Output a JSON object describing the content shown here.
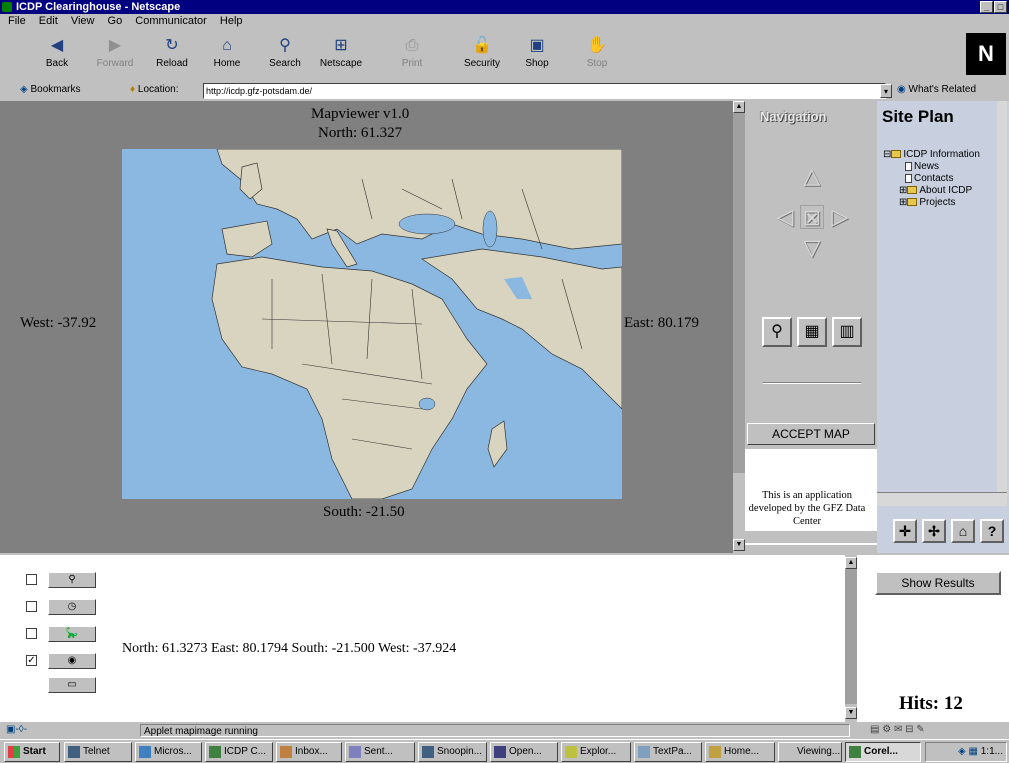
{
  "window": {
    "title": "ICDP Clearinghouse - Netscape"
  },
  "menu": [
    "File",
    "Edit",
    "View",
    "Go",
    "Communicator",
    "Help"
  ],
  "toolbar": [
    {
      "label": "Back",
      "icon": "back-arrow-icon",
      "glyph": "◀",
      "disabled": false
    },
    {
      "label": "Forward",
      "icon": "forward-arrow-icon",
      "glyph": "▶",
      "disabled": true
    },
    {
      "label": "Reload",
      "icon": "reload-icon",
      "glyph": "↻",
      "disabled": false
    },
    {
      "label": "Home",
      "icon": "home-icon",
      "glyph": "⌂",
      "disabled": false
    },
    {
      "label": "Search",
      "icon": "search-icon",
      "glyph": "⚲",
      "disabled": false
    },
    {
      "label": "Netscape",
      "icon": "netscape-icon",
      "glyph": "⊞",
      "disabled": false
    },
    {
      "label": "Print",
      "icon": "print-icon",
      "glyph": "⎙",
      "disabled": true
    },
    {
      "label": "Security",
      "icon": "lock-icon",
      "glyph": "🔓",
      "disabled": false
    },
    {
      "label": "Shop",
      "icon": "shop-icon",
      "glyph": "▣",
      "disabled": false
    },
    {
      "label": "Stop",
      "icon": "stop-icon",
      "glyph": "✋",
      "disabled": true
    }
  ],
  "locationbar": {
    "bookmarks": "Bookmarks",
    "location_label": "Location:",
    "url": "http://icdp.gfz-potsdam.de/",
    "whats_related": "What's Related"
  },
  "map": {
    "title": "Mapviewer v1.0",
    "north": "North: 61.327",
    "south": "South: -21.50",
    "west": "West: -37.92",
    "east": "East: 80.179",
    "ocean_color": "#8ab8e0",
    "land_color": "#d8d4c0"
  },
  "navigation": {
    "title": "Navigation",
    "accept_map": "ACCEPT MAP",
    "info_text": "This is an application developed by the GFZ Data Center"
  },
  "site_plan": {
    "title": "Site Plan",
    "tree": [
      {
        "label": "ICDP Information",
        "type": "folder",
        "level": 0
      },
      {
        "label": "News",
        "type": "doc",
        "level": 1
      },
      {
        "label": "Contacts",
        "type": "doc",
        "level": 1
      },
      {
        "label": "About ICDP",
        "type": "folder",
        "level": 1
      },
      {
        "label": "Projects",
        "type": "folder",
        "level": 1
      }
    ]
  },
  "query": {
    "layers": [
      {
        "icon": "search-icon",
        "glyph": "⚲",
        "checked": false
      },
      {
        "icon": "clock-icon",
        "glyph": "◷",
        "checked": false
      },
      {
        "icon": "dinosaur-icon",
        "glyph": "🦕",
        "checked": false
      },
      {
        "icon": "globe-icon",
        "glyph": "🌍",
        "checked": true
      }
    ],
    "extra_button_icon": "rectangle-icon",
    "coords": "North: 61.3273 East: 80.1794 South: -21.500 West: -37.924",
    "show_results": "Show Results",
    "hits": "Hits: 12"
  },
  "status": {
    "text": "Applet mapimage running"
  },
  "taskbar": {
    "start": "Start",
    "tasks": [
      "Telnet",
      "Micros...",
      "ICDP C...",
      "Inbox...",
      "Sent...",
      "Snoopin...",
      "Open...",
      "Explor...",
      "TextPa...",
      "Home...",
      "Viewing...",
      "Corel..."
    ],
    "clock": "1:1..."
  }
}
